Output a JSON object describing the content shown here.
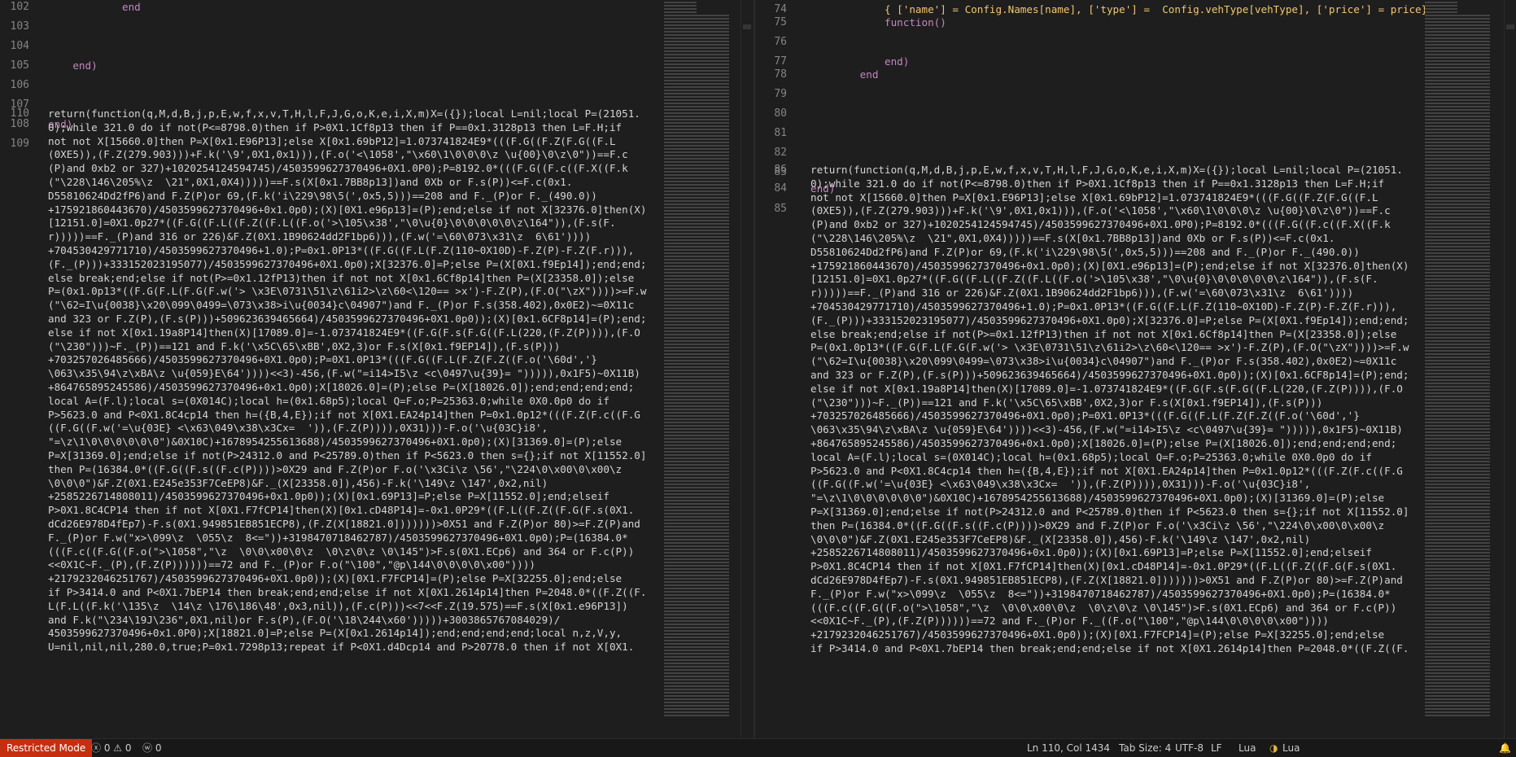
{
  "left_pane": {
    "line_numbers": [
      "102",
      "103",
      "104",
      "105",
      "106",
      "107",
      "108",
      "109",
      "110"
    ],
    "header_lines": [
      {
        "indent": "            ",
        "text": "end",
        "kind": "kw"
      },
      {
        "indent": "",
        "text": "",
        "kind": "plain"
      },
      {
        "indent": "",
        "text": "",
        "kind": "plain"
      },
      {
        "indent": "    ",
        "text": "end)",
        "kind": "kw"
      },
      {
        "indent": "",
        "text": "",
        "kind": "plain"
      },
      {
        "indent": "",
        "text": "",
        "kind": "plain"
      },
      {
        "indent": "",
        "text": "end)",
        "kind": "kw"
      },
      {
        "indent": "",
        "text": "",
        "kind": "plain"
      }
    ],
    "wrapped_code": [
      "return(function(q,M,d,B,j,p,E,w,f,x,v,T,H,l,F,J,G,o,K,e,i,X,m)X=({});local L=nil;local P=(21051.",
      "0);while 321.0 do if not(P<=8798.0)then if P>0X1.1Cf8p13 then if P==0x1.3128p13 then L=F.H;if",
      "not not X[15660.0]then P=X[0x1.E96P13];else X[0x1.69bP12]=1.073741824E9*(((F.G((F.Z(F.G((F.L",
      "(0XE5)),(F.Z(279.903)))+F.k('\\9',0X1,0x1))),(F.o('<\\1058',\"\\x60\\1\\0\\0\\0\\z \\u{00}\\0\\z\\0\"))==F.c",
      "(P)and 0xb2 or 327)+1020254124594745)/4503599627370496+0X1.0P0);P=8192.0*(((F.G((F.c((F.X((F.k",
      "(\"\\228\\146\\205%\\z  \\21\",0X1,0X4)))))==F.s(X[0x1.7BB8p13])and 0Xb or F.s(P))<=F.c(0x1.",
      "D55810624Dd2fP6)and F.Z(P)or 69,(F.k('i\\229\\98\\5(',0x5,5)))==208 and F._(P)or F._(490.0))",
      "+175921860443670)/4503599627370496+0x1.0p0);(X)[0X1.e96p13]=(P);end;else if not X[32376.0]then(X)",
      "[12151.0]=0X1.0p27*((F.G((F.L((F.Z((F.L((F.o('>\\105\\x38',\"\\0\\u{0}\\0\\0\\0\\0\\0\\z\\164\")),(F.s(F.",
      "r)))))==F._(P)and 316 or 226)&F.Z(0X1.1B90624dd2F1bp6))),(F.w('=\\60\\073\\x31\\z  6\\61'))))",
      "+704530429771710)/4503599627370496+1.0);P=0x1.0P13*((F.G((F.L(F.Z(110~0X10D)-F.Z(P)-F.Z(F.r))),",
      "(F._(P)))+333152023195077)/4503599627370496+0X1.0p0);X[32376.0]=P;else P=(X[0X1.f9Ep14]);end;end;",
      "else break;end;else if not(P>=0x1.12fP13)then if not not X[0x1.6Cf8p14]then P=(X[23358.0]);else",
      "P=(0x1.0p13*((F.G(F.L(F.G(F.w('> \\x3E\\0731\\51\\z\\61i2>\\z\\60<\\120== >x')-F.Z(P),(F.O(\"\\zX\"))))>=F.w",
      "(\"\\62=I\\u{0038}\\x20\\099\\0499=\\073\\x38>i\\u{0034}c\\04907\")and F._(P)or F.s(358.402),0x0E2)~=0X11c",
      "and 323 or F.Z(P),(F.s(P)))+509623639465664)/4503599627370496+0X1.0p0));(X)[0x1.6CF8p14]=(P);end;",
      "else if not X[0x1.19a8P14]then(X)[17089.0]=-1.073741824E9*((F.G(F.s(F.G((F.L(220,(F.Z(P)))),(F.O",
      "(\"\\230\")))~F._(P))==121 and F.k('\\x5C\\65\\xBB',0X2,3)or F.s(X[0x1.f9EP14]),(F.s(P)))",
      "+703257026485666)/4503599627370496+0X1.0p0);P=0X1.0P13*(((F.G((F.L(F.Z(F.Z((F.o('\\60d','}",
      "\\063\\x35\\94\\z\\xBA\\z \\u{059}E\\64'))))<<3)-456,(F.w(\"=i14>I5\\z <c\\0497\\u{39}= \"))))),0x1F5)~0X11B)",
      "+864765895245586)/4503599627370496+0x1.0p0);X[18026.0]=(P);else P=(X[18026.0]);end;end;end;end;",
      "local A=(F.l);local s=(0X014C);local h=(0x1.68p5);local Q=F.o;P=25363.0;while 0X0.0p0 do if",
      "P>5623.0 and P<0X1.8C4cp14 then h=({B,4,E});if not X[0X1.EA24p14]then P=0x1.0p12*(((F.Z(F.c((F.G",
      "((F.G((F.w('=\\u{03E} <\\x63\\049\\x38\\x3Cx=  ')),(F.Z(P)))),0X31)))-F.o('\\u{03C}i8',",
      "\"=\\z\\1\\0\\0\\0\\0\\0\\0\")&0X10C)+1678954255613688)/4503599627370496+0X1.0p0);(X)[31369.0]=(P);else",
      "P=X[31369.0];end;else if not(P>24312.0 and P<25789.0)then if P<5623.0 then s={};if not X[11552.0]",
      "then P=(16384.0*((F.G((F.s((F.c(P))))>0X29 and F.Z(P)or F.o('\\x3Ci\\z \\56',\"\\224\\0\\x00\\0\\x00\\z",
      "\\0\\0\\0\")&F.Z(0X1.E245e353F7CeEP8)&F._(X[23358.0]),456)-F.k('\\149\\z \\147',0x2,nil)",
      "+2585226714808011)/4503599627370496+0x1.0p0));(X)[0x1.69P13]=P;else P=X[11552.0];end;elseif",
      "P>0X1.8C4CP14 then if not X[0X1.F7fCP14]then(X)[0x1.cD48P14]=-0x1.0P29*((F.L((F.Z((F.G(F.s(0X1.",
      "dCd26E978D4fEp7)-F.s(0X1.949851EB851ECP8),(F.Z(X[18821.0]))))))>0X51 and F.Z(P)or 80)>=F.Z(P)and",
      "F._(P)or F.w(\"x>\\099\\z  \\055\\z  8<=\"))+3198470718462787)/4503599627370496+0X1.0p0);P=(16384.0*",
      "(((F.c((F.G((F.o(\">\\1058\",\"\\z  \\0\\0\\x00\\0\\z  \\0\\z\\0\\z \\0\\145\")>F.s(0X1.ECp6) and 364 or F.c(P))",
      "<<0X1C~F._(P),(F.Z(P))))))==72 and F._(P)or F.o(\"\\100\",\"@p\\144\\0\\0\\0\\0\\x00\"))))",
      "+2179232046251767)/4503599627370496+0X1.0p0));(X)[0X1.F7FCP14]=(P);else P=X[32255.0];end;else",
      "if P>3414.0 and P<0X1.7bEP14 then break;end;end;else if not X[0X1.2614p14]then P=2048.0*((F.Z((F.",
      "L(F.L((F.k('\\135\\z  \\14\\z \\176\\186\\48',0x3,nil)),(F.c(P)))<<7<<F.Z(19.575)==F.s(X[0x1.e96P13])",
      "and F.k(\"\\234\\19J\\236\",0X1,nil)or F.s(P),(F.O('\\18\\244\\x60')))))+3003865767084029)/",
      "4503599627370496+0x1.0P0);X[18821.0]=P;else P=(X[0x1.2614p14]);end;end;end;end;local n,z,V,y,",
      "U=nil,nil,nil,280.0,true;P=0x1.7298p13;repeat if P<0X1.d4Dcp14 and P>20778.0 then if not X[0X1."
    ]
  },
  "right_pane": {
    "line_numbers": [
      "74",
      "75",
      "76",
      "77",
      "78",
      "79",
      "80",
      "81",
      "82",
      "83",
      "84",
      "85",
      "86"
    ],
    "top_partial": "                { ['name'] = Config.Names[name], ['type'] =  Config.vehType[vehType], ['price'] = price},",
    "header_lines": [
      {
        "indent": "            ",
        "text": "{ ['name'] = Config.Names[name], ['type'] =  Config.vehType[vehType], ['price'] = price},",
        "kind": "table"
      },
      {
        "indent": "            ",
        "text": "function()",
        "kind": "fnkw"
      },
      {
        "indent": "",
        "text": "",
        "kind": "plain"
      },
      {
        "indent": "            ",
        "text": "end)",
        "kind": "kw"
      },
      {
        "indent": "        ",
        "text": "end",
        "kind": "kw"
      },
      {
        "indent": "",
        "text": "",
        "kind": "plain"
      },
      {
        "indent": "",
        "text": "",
        "kind": "plain"
      },
      {
        "indent": "",
        "text": "",
        "kind": "plain"
      },
      {
        "indent": "",
        "text": "",
        "kind": "plain"
      },
      {
        "indent": "",
        "text": "",
        "kind": "plain"
      },
      {
        "indent": "",
        "text": "end)",
        "kind": "kw"
      },
      {
        "indent": "",
        "text": "",
        "kind": "plain"
      }
    ],
    "wrapped_code": [
      "return(function(q,M,d,B,j,p,E,w,f,x,v,T,H,l,F,J,G,o,K,e,i,X,m)X=({});local L=nil;local P=(21051.",
      "0);while 321.0 do if not(P<=8798.0)then if P>0X1.1Cf8p13 then if P==0x1.3128p13 then L=F.H;if",
      "not not X[15660.0]then P=X[0x1.E96P13];else X[0x1.69bP12]=1.073741824E9*(((F.G((F.Z(F.G((F.L",
      "(0XE5)),(F.Z(279.903)))+F.k('\\9',0X1,0x1))),(F.o('<\\1058',\"\\x60\\1\\0\\0\\0\\z \\u{00}\\0\\z\\0\"))==F.c",
      "(P)and 0xb2 or 327)+1020254124594745)/4503599627370496+0X1.0P0);P=8192.0*(((F.G((F.c((F.X((F.k",
      "(\"\\228\\146\\205%\\z  \\21\",0X1,0X4)))))==F.s(X[0x1.7BB8p13])and 0Xb or F.s(P))<=F.c(0x1.",
      "D55810624Dd2fP6)and F.Z(P)or 69,(F.k('i\\229\\98\\5(',0x5,5)))==208 and F._(P)or F._(490.0))",
      "+175921860443670)/4503599627370496+0x1.0p0);(X)[0X1.e96p13]=(P);end;else if not X[32376.0]then(X)",
      "[12151.0]=0X1.0p27*((F.G((F.L((F.Z((F.L((F.o('>\\105\\x38',\"\\0\\u{0}\\0\\0\\0\\0\\0\\z\\164\")),(F.s(F.",
      "r)))))==F._(P)and 316 or 226)&F.Z(0X1.1B90624dd2F1bp6))),(F.w('=\\60\\073\\x31\\z  6\\61'))))",
      "+704530429771710)/4503599627370496+1.0);P=0x1.0P13*((F.G((F.L(F.Z(110~0X10D)-F.Z(P)-F.Z(F.r))),",
      "(F._(P)))+333152023195077)/4503599627370496+0X1.0p0);X[32376.0]=P;else P=(X[0X1.f9Ep14]);end;end;",
      "else break;end;else if not(P>=0x1.12fP13)then if not not X[0x1.6Cf8p14]then P=(X[23358.0]);else",
      "P=(0x1.0p13*((F.G(F.L(F.G(F.w('> \\x3E\\0731\\51\\z\\61i2>\\z\\60<\\120== >x')-F.Z(P),(F.O(\"\\zX\"))))>=F.w",
      "(\"\\62=I\\u{0038}\\x20\\099\\0499=\\073\\x38>i\\u{0034}c\\04907\")and F._(P)or F.s(358.402),0x0E2)~=0X11c",
      "and 323 or F.Z(P),(F.s(P)))+509623639465664)/4503599627370496+0X1.0p0));(X)[0x1.6CF8p14]=(P);end;",
      "else if not X[0x1.19a8P14]then(X)[17089.0]=-1.073741824E9*((F.G(F.s(F.G((F.L(220,(F.Z(P)))),(F.O",
      "(\"\\230\")))~F._(P))==121 and F.k('\\x5C\\65\\xBB',0X2,3)or F.s(X[0x1.f9EP14]),(F.s(P)))",
      "+703257026485666)/4503599627370496+0X1.0p0);P=0X1.0P13*(((F.G((F.L(F.Z(F.Z((F.o('\\60d','}",
      "\\063\\x35\\94\\z\\xBA\\z \\u{059}E\\64'))))<<3)-456,(F.w(\"=i14>I5\\z <c\\0497\\u{39}= \"))))),0x1F5)~0X11B)",
      "+864765895245586)/4503599627370496+0x1.0p0);X[18026.0]=(P);else P=(X[18026.0]);end;end;end;end;",
      "local A=(F.l);local s=(0X014C);local h=(0x1.68p5);local Q=F.o;P=25363.0;while 0X0.0p0 do if",
      "P>5623.0 and P<0X1.8C4cp14 then h=({B,4,E});if not X[0X1.EA24p14]then P=0x1.0p12*(((F.Z(F.c((F.G",
      "((F.G((F.w('=\\u{03E} <\\x63\\049\\x38\\x3Cx=  ')),(F.Z(P)))),0X31)))-F.o('\\u{03C}i8',",
      "\"=\\z\\1\\0\\0\\0\\0\\0\\0\")&0X10C)+1678954255613688)/4503599627370496+0X1.0p0);(X)[31369.0]=(P);else",
      "P=X[31369.0];end;else if not(P>24312.0 and P<25789.0)then if P<5623.0 then s={};if not X[11552.0]",
      "then P=(16384.0*((F.G((F.s((F.c(P))))>0X29 and F.Z(P)or F.o('\\x3Ci\\z \\56',\"\\224\\0\\x00\\0\\x00\\z",
      "\\0\\0\\0\")&F.Z(0X1.E245e353F7CeEP8)&F._(X[23358.0]),456)-F.k('\\149\\z \\147',0x2,nil)",
      "+2585226714808011)/4503599627370496+0x1.0p0));(X)[0x1.69P13]=P;else P=X[11552.0];end;elseif",
      "P>0X1.8C4CP14 then if not X[0X1.F7fCP14]then(X)[0x1.cD48P14]=-0x1.0P29*((F.L((F.Z((F.G(F.s(0X1.",
      "dCd26E978D4fEp7)-F.s(0X1.949851EB851ECP8),(F.Z(X[18821.0]))))))>0X51 and F.Z(P)or 80)>=F.Z(P)and",
      "F._(P)or F.w(\"x>\\099\\z  \\055\\z  8<=\"))+3198470718462787)/4503599627370496+0X1.0p0);P=(16384.0*",
      "(((F.c((F.G((F.o(\">\\1058\",\"\\z  \\0\\0\\x00\\0\\z  \\0\\z\\0\\z \\0\\145\")>F.s(0X1.ECp6) and 364 or F.c(P))",
      "<<0X1C~F._(P),(F.Z(P))))))==72 and F._(P)or F._((F.o(\"\\100\",\"@p\\144\\0\\0\\0\\0\\x00\"))))",
      "+2179232046251767)/4503599627370496+0X1.0p0));(X)[0X1.F7FCP14]=(P);else P=X[32255.0];end;else",
      "if P>3414.0 and P<0X1.7bEP14 then break;end;end;else if not X[0X1.2614p14]then P=2048.0*((F.Z((F."
    ]
  },
  "status_bar": {
    "restricted_mode": "Restricted Mode",
    "problems": "ⓧ 0 ⚠ 0",
    "ports": "ⓦ 0",
    "cursor_position": "Ln 110, Col 1434",
    "tab_size": "Tab Size: 4",
    "encoding": "UTF-8",
    "eol": "LF",
    "language": "Lua",
    "language_mode_right": "Lua"
  }
}
